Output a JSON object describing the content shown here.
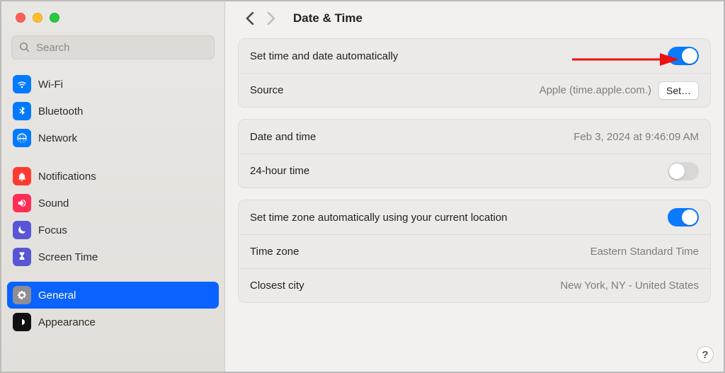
{
  "sidebar": {
    "search_placeholder": "Search",
    "items": [
      {
        "label": "Wi-Fi"
      },
      {
        "label": "Bluetooth"
      },
      {
        "label": "Network"
      },
      {
        "label": "Notifications"
      },
      {
        "label": "Sound"
      },
      {
        "label": "Focus"
      },
      {
        "label": "Screen Time"
      },
      {
        "label": "General"
      },
      {
        "label": "Appearance"
      }
    ]
  },
  "header": {
    "title": "Date & Time"
  },
  "rows": {
    "auto_time_label": "Set time and date automatically",
    "auto_time_on": true,
    "source_label": "Source",
    "source_value": "Apple (time.apple.com.)",
    "set_button": "Set…",
    "date_time_label": "Date and time",
    "date_time_value": "Feb 3, 2024 at 9:46:09 AM",
    "twenty_four_label": "24-hour time",
    "twenty_four_on": false,
    "auto_tz_label": "Set time zone automatically using your current location",
    "auto_tz_on": true,
    "tz_label": "Time zone",
    "tz_value": "Eastern Standard Time",
    "city_label": "Closest city",
    "city_value": "New York, NY - United States"
  },
  "help": "?"
}
